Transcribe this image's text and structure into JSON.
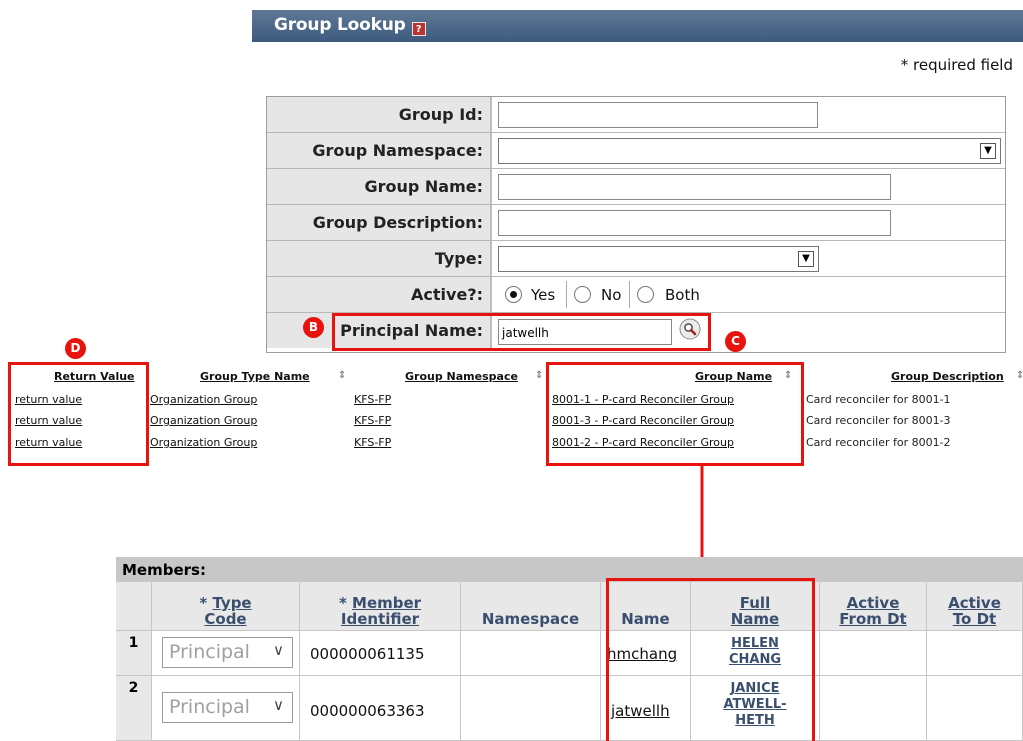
{
  "header": {
    "title": "Group Lookup",
    "help_icon": "?",
    "required_note": "* required field"
  },
  "form": {
    "group_id_label": "Group Id:",
    "group_id_value": "",
    "group_namespace_label": "Group Namespace:",
    "group_namespace_value": "",
    "group_name_label": "Group Name:",
    "group_name_value": "",
    "group_description_label": "Group Description:",
    "group_description_value": "",
    "type_label": "Type:",
    "type_value": "",
    "active_label": "Active?:",
    "active_options": [
      "Yes",
      "No",
      "Both"
    ],
    "active_selected": "Yes",
    "principal_name_label": "Principal Name:",
    "principal_name_value": "jatwellh",
    "lookup_icon": "magnifier-icon"
  },
  "callouts": {
    "b": "B",
    "c": "C",
    "d": "D",
    "color": "#e8130d"
  },
  "results": {
    "headers": {
      "return_value": "Return Value",
      "group_type_name": "Group Type Name",
      "group_namespace": "Group Namespace",
      "group_name": "Group Name",
      "group_description": "Group Description"
    },
    "rows": [
      {
        "return_value": "return value",
        "type_name": "Organization Group",
        "namespace": "KFS-FP",
        "group_name": "8001-1 - P-card Reconciler Group",
        "description": "Card reconciler for 8001-1"
      },
      {
        "return_value": "return value",
        "type_name": "Organization Group",
        "namespace": "KFS-FP",
        "group_name": "8001-3 - P-card Reconciler Group",
        "description": "Card reconciler for 8001-3"
      },
      {
        "return_value": "return value",
        "type_name": "Organization Group",
        "namespace": "KFS-FP",
        "group_name": "8001-2 - P-card Reconciler Group",
        "description": "Card reconciler for 8001-2"
      }
    ]
  },
  "members": {
    "title": "Members:",
    "headers": {
      "type_prefix": "* ",
      "type_line1": "Type",
      "type_line2": "Code",
      "id_prefix": "* ",
      "id_line1": "Member",
      "id_line2": "Identifier",
      "namespace": "Namespace",
      "name": "Name",
      "full_line1": "Full",
      "full_line2": "Name",
      "from_line1": "Active",
      "from_line2": "From Dt",
      "to_line1": "Active",
      "to_line2": "To Dt"
    },
    "rows": [
      {
        "num": "1",
        "type_code": "Principal",
        "member_id": "000000061135",
        "namespace": "",
        "name": "hmchang",
        "full_line1": "HELEN",
        "full_line2": "CHANG",
        "full_line3": ""
      },
      {
        "num": "2",
        "type_code": "Principal",
        "member_id": "000000063363",
        "namespace": "",
        "name": "jatwellh",
        "full_line1": "JANICE",
        "full_line2": "ATWELL-",
        "full_line3": "HETH"
      }
    ]
  }
}
